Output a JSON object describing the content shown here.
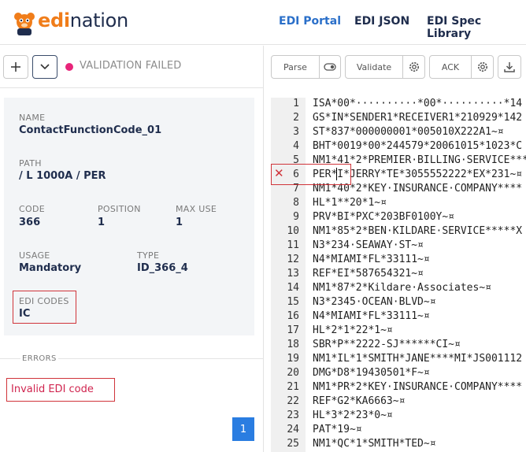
{
  "brand": {
    "part1": "edi",
    "part2": "nation"
  },
  "nav": {
    "portal": "EDI Portal",
    "json": "EDI JSON",
    "spec": "EDI Spec Library"
  },
  "toolbar": {
    "add_icon": "plus-icon",
    "dropdown_icon": "chevron-down-icon",
    "status": "VALIDATION FAILED"
  },
  "details": {
    "name_label": "NAME",
    "name": "ContactFunctionCode_01",
    "path_label": "PATH",
    "path": "/ L 1000A / PER",
    "code_label": "CODE",
    "code": "366",
    "position_label": "POSITION",
    "position": "1",
    "maxuse_label": "MAX USE",
    "maxuse": "1",
    "usage_label": "USAGE",
    "usage": "Mandatory",
    "type_label": "TYPE",
    "type": "ID_366_4",
    "edicodes_label": "EDI CODES",
    "edicodes": "IC"
  },
  "errors": {
    "label": "ERRORS",
    "message": "Invalid EDI code",
    "page": "1"
  },
  "editor_toolbar": {
    "parse": "Parse",
    "validate": "Validate",
    "ack": "ACK"
  },
  "colors": {
    "accent": "#2a7de1",
    "brand_orange": "#f07d1a",
    "error": "#d0343a",
    "status_dot": "#e8257a"
  },
  "editor": {
    "line_numbers": [
      "1",
      "2",
      "3",
      "4",
      "5",
      "6",
      "7",
      "8",
      "9",
      "10",
      "11",
      "12",
      "13",
      "14",
      "15",
      "16",
      "17",
      "18",
      "19",
      "20",
      "21",
      "22",
      "23",
      "24",
      "25"
    ],
    "lines": [
      "ISA*00*··········*00*··········*14",
      "GS*IN*SENDER1*RECEIVER1*210929*142",
      "ST*837*000000001*005010X222A1~¤",
      "BHT*0019*00*244579*20061015*1023*C",
      "NM1*41*2*PREMIER·BILLING·SERVICE***",
      "PER*I*JERRY*TE*3055552222*EX*231~¤",
      "NM1*40*2*KEY·INSURANCE·COMPANY****",
      "HL*1**20*1~¤",
      "PRV*BI*PXC*203BF0100Y~¤",
      "NM1*85*2*BEN·KILDARE·SERVICE*****X",
      "N3*234·SEAWAY·ST~¤",
      "N4*MIAMI*FL*33111~¤",
      "REF*EI*587654321~¤",
      "NM1*87*2*Kildare·Associates~¤",
      "N3*2345·OCEAN·BLVD~¤",
      "N4*MIAMI*FL*33111~¤",
      "HL*2*1*22*1~¤",
      "SBR*P**2222-SJ******CI~¤",
      "NM1*IL*1*SMITH*JANE****MI*JS001112",
      "DMG*D8*19430501*F~¤",
      "NM1*PR*2*KEY·INSURANCE·COMPANY****",
      "REF*G2*KA6663~¤",
      "HL*3*2*23*0~¤",
      "PAT*19~¤",
      "NM1*QC*1*SMITH*TED~¤"
    ]
  }
}
